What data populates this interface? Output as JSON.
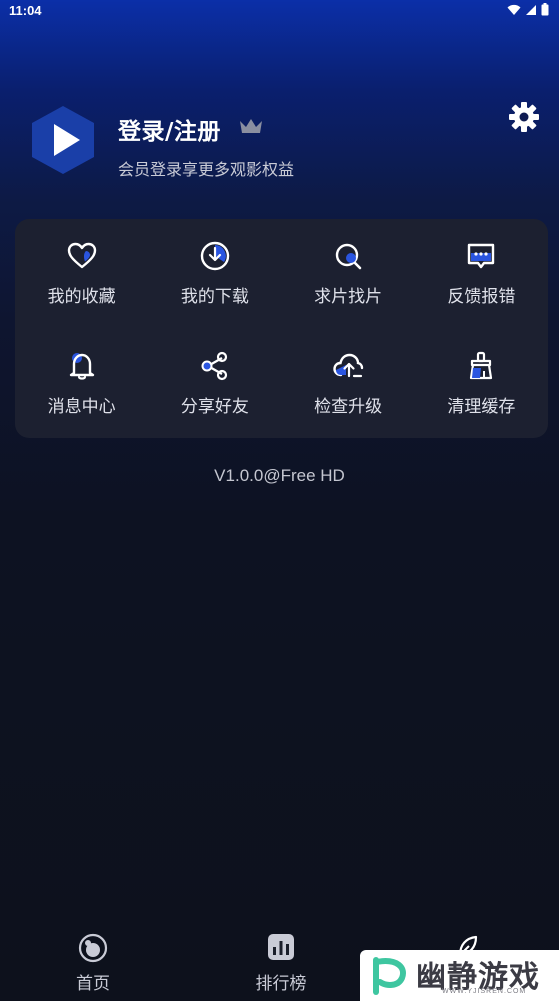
{
  "status_bar": {
    "time": "11:04"
  },
  "profile": {
    "title": "登录/注册",
    "subtitle": "会员登录享更多观影权益"
  },
  "menu": {
    "items": [
      {
        "label": "我的收藏",
        "icon": "heart-icon"
      },
      {
        "label": "我的下载",
        "icon": "download-clock-icon"
      },
      {
        "label": "求片找片",
        "icon": "search-icon"
      },
      {
        "label": "反馈报错",
        "icon": "feedback-icon"
      },
      {
        "label": "消息中心",
        "icon": "bell-icon"
      },
      {
        "label": "分享好友",
        "icon": "share-icon"
      },
      {
        "label": "检查升级",
        "icon": "cloud-upload-icon"
      },
      {
        "label": "清理缓存",
        "icon": "brush-icon"
      }
    ]
  },
  "version": "V1.0.0@Free HD",
  "tabs": [
    {
      "label": "首页",
      "icon": "home-icon"
    },
    {
      "label": "排行榜",
      "icon": "ranking-icon"
    },
    {
      "label": "",
      "icon": "profile-leaf-icon"
    }
  ],
  "watermark": {
    "text": "幽静游戏",
    "url": "WWW.YJISREN.COM"
  },
  "colors": {
    "accent": "#2a55e0",
    "card": "#1c2030",
    "brand_logo": "#1a3fa8"
  }
}
